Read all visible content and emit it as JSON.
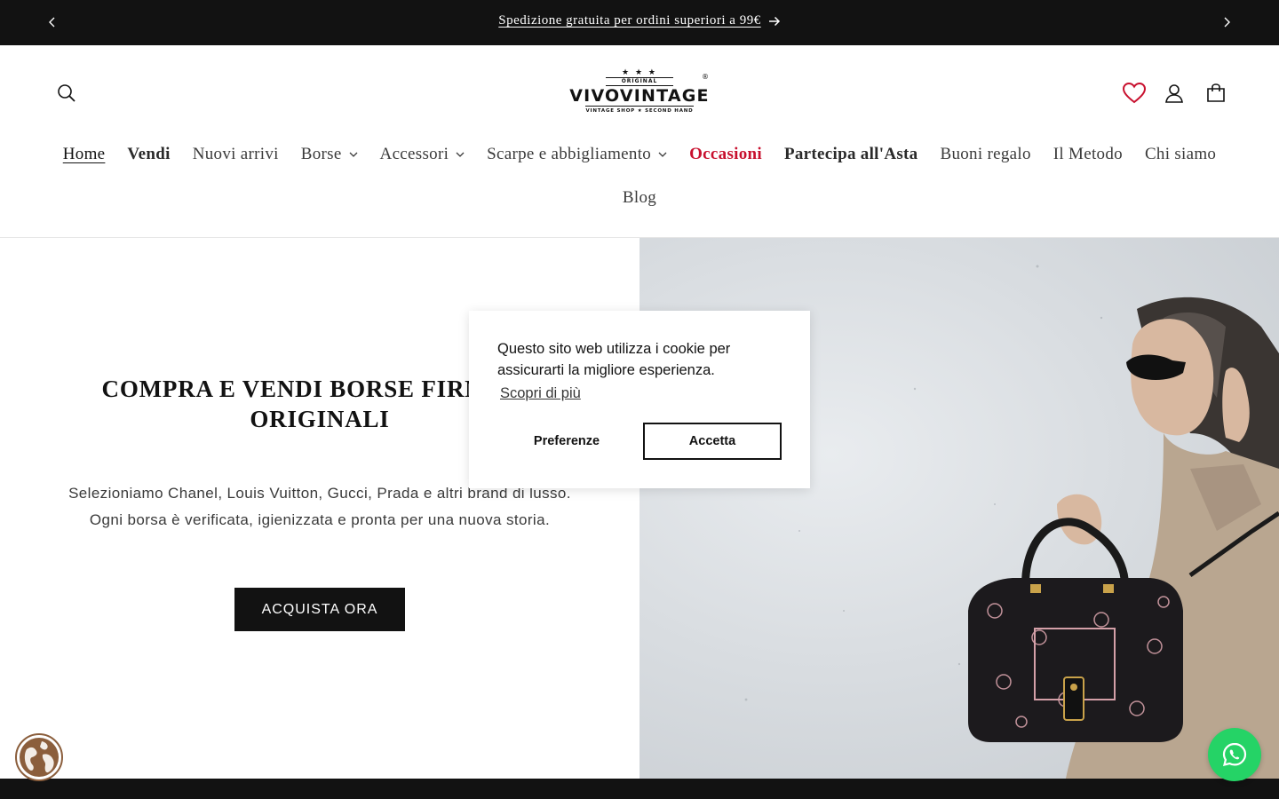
{
  "announcement": {
    "message": "Spedizione gratuita per ordini superiori a 99€",
    "prev_icon": "chevron-left-icon",
    "next_icon": "chevron-right-icon",
    "arrow_icon": "arrow-right-icon"
  },
  "header": {
    "logo": {
      "stars": "★ ★ ★",
      "top_text": "ORIGINAL",
      "brand": "VIVOVINTAGE",
      "tagline": "VINTAGE SHOP ★ SECOND HAND",
      "registered": "®"
    },
    "icons": [
      "search-icon",
      "heart-icon",
      "account-icon",
      "cart-icon"
    ]
  },
  "menu": {
    "row1": [
      {
        "label": "Home",
        "style": "active"
      },
      {
        "label": "Vendi",
        "style": "bold"
      },
      {
        "label": "Nuovi arrivi",
        "style": "normal"
      },
      {
        "label": "Borse",
        "style": "dropdown"
      },
      {
        "label": "Accessori",
        "style": "dropdown"
      },
      {
        "label": "Scarpe e abbigliamento",
        "style": "dropdown"
      },
      {
        "label": "Occasioni",
        "style": "red"
      },
      {
        "label": "Partecipa all'Asta",
        "style": "bold"
      },
      {
        "label": "Buoni regalo",
        "style": "normal"
      },
      {
        "label": "Il Metodo",
        "style": "normal"
      },
      {
        "label": "Chi siamo",
        "style": "normal"
      }
    ],
    "row2": [
      {
        "label": "Blog",
        "style": "normal"
      }
    ]
  },
  "hero": {
    "title_line1": "COMPRA E VENDI BORSE FIRMATE",
    "title_line2": "ORIGINALI",
    "subtitle_line1": "Selezioniamo Chanel, Louis Vuitton, Gucci, Prada e altri brand di lusso.",
    "subtitle_line2": "Ogni borsa è verificata, igienizzata e pronta per una nuova storia.",
    "cta_label": "ACQUISTA ORA"
  },
  "cookie": {
    "message": "Questo sito web utilizza i cookie per assicurarti la migliore esperienza.",
    "learn_more": "Scopri di più",
    "preferences_label": "Preferenze",
    "accept_label": "Accetta"
  },
  "floating": {
    "language_icon": "globe-icon",
    "chat_icon": "whatsapp-icon"
  },
  "colors": {
    "dark": "#121212",
    "accent_red": "#c8102e",
    "whatsapp_green": "#25d366",
    "globe_brown": "#8b5e3c"
  }
}
